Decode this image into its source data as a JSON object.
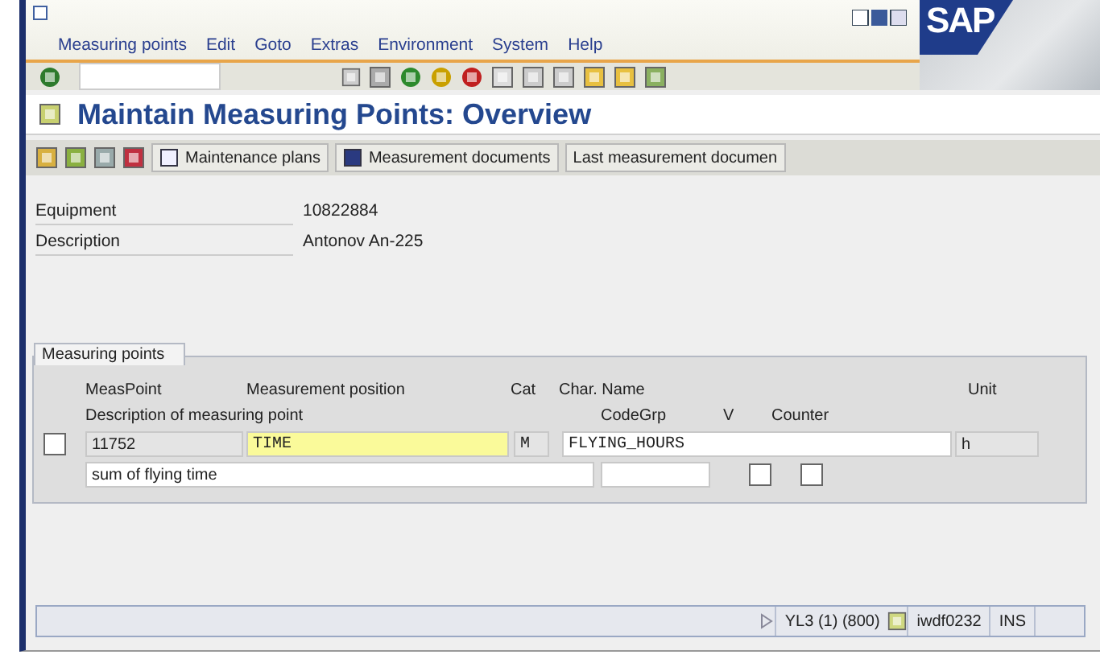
{
  "menu": [
    "Measuring points",
    "Edit",
    "Goto",
    "Extras",
    "Environment",
    "System",
    "Help"
  ],
  "logo": "SAP",
  "title": "Maintain Measuring Points: Overview",
  "app_toolbar": [
    "Maintenance plans",
    "Measurement documents",
    "Last measurement documen"
  ],
  "header_fields": [
    {
      "label": "Equipment",
      "value": "10822884"
    },
    {
      "label": "Description",
      "value": "Antonov An-225"
    }
  ],
  "group": {
    "title": "Measuring points",
    "headers_line_1": [
      "MeasPoint",
      "Measurement position",
      "Cat",
      "Char. Name",
      "Unit"
    ],
    "headers_line_2": [
      "Description of measuring point",
      "CodeGrp",
      "V",
      "Counter"
    ],
    "rows": [
      {
        "selected": false,
        "meas_point": "11752",
        "position": "TIME",
        "cat": "M",
        "char_name": "FLYING_HOURS",
        "unit": "h",
        "description": "sum of flying time",
        "v_checked": false,
        "counter_checked": false
      }
    ]
  },
  "status_bar": {
    "system": "YL3 (1) (800)",
    "server": "iwdf0232",
    "mode": "INS"
  }
}
